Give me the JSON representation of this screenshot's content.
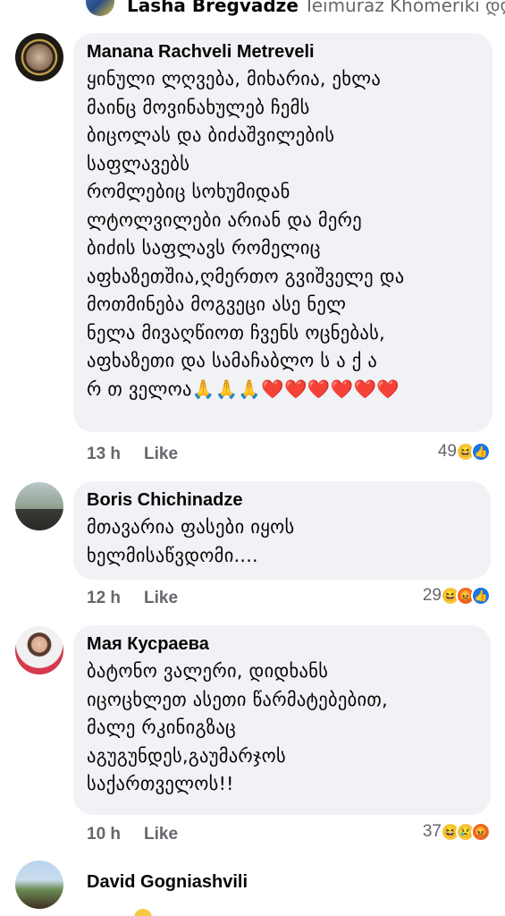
{
  "top": {
    "author": "Lasha Bregvadze",
    "text": "Teimuraz Khomeriki დღ..."
  },
  "comments": [
    {
      "author": "Manana Rachveli Metreveli",
      "text": "ყინული ლღვება, მიხარია, ეხლა\nმაინც მოვინახულებ ჩემს\nბიცოლას და ბიძაშვილების\nსაფლავებს\nრომლებიც სოხუმიდან\nლტოლვილები არიან და მერე\nბიძის საფლავს რომელიც\nაფხაზეთშია,ღმერთო გვიშველე და\nმოთმინება მოგვეცი ასე ნელ\nნელა მივაღწიოთ ჩვენს ოცნებას,\nაფხაზეთი და სამაჩაბლო ს ა ქ ა\nრ თ ველოა🙏🙏🙏❤️❤️❤️❤️❤️❤️",
      "time": "13 h",
      "like": "Like",
      "reaction_count": "49",
      "reactions": [
        "haha-icon",
        "like-icon"
      ]
    },
    {
      "author": "Boris Chichinadze",
      "text": "მთავარია ფასები იყოს\nხელმისაწვდომი....",
      "time": "12 h",
      "like": "Like",
      "reaction_count": "29",
      "reactions": [
        "haha-icon",
        "angry-icon",
        "like-icon"
      ]
    },
    {
      "author": "Мая Кусраева",
      "text": "ბატონო ვალერი, დიდხანს\nიცოცხლეთ ასეთი წარმატებებით,\nმალე რკინიგზაც\nაგუგუნდეს,გაუმარჯოს\nსაქართველოს!!",
      "time": "10 h",
      "like": "Like",
      "reaction_count": "37",
      "reactions": [
        "haha-icon",
        "sad-icon",
        "angry-icon"
      ]
    },
    {
      "author": "David  Gogniashvili"
    }
  ],
  "colors": {
    "bubble": "#f0f2f5",
    "meta": "#65676b",
    "like_blue": "#1b74e4"
  }
}
